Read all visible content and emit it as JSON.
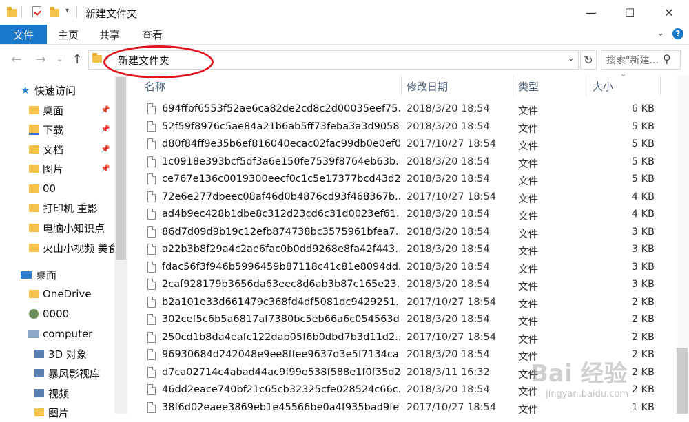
{
  "window": {
    "title": "新建文件夹",
    "minimize_glyph": "—",
    "maximize_glyph": "☐",
    "close_glyph": "✕"
  },
  "ribbon": {
    "file": "文件",
    "tabs": [
      "主页",
      "共享",
      "查看"
    ],
    "expand_glyph": "⌄",
    "help_glyph": "?"
  },
  "address": {
    "path": "新建文件夹",
    "search_placeholder": "搜索\"新建...",
    "back_glyph": "←",
    "forward_glyph": "→",
    "up_glyph": "↑",
    "dropdown_glyph": "⌄",
    "refresh_glyph": "↻",
    "search_glyph": "⚲"
  },
  "nav": {
    "items": [
      {
        "label": "快速访问",
        "icon": "star-icon",
        "pinned": false
      },
      {
        "label": "桌面",
        "icon": "desktop-folder-icon",
        "pinned": true
      },
      {
        "label": "下载",
        "icon": "download-folder-icon",
        "pinned": true
      },
      {
        "label": "文档",
        "icon": "documents-folder-icon",
        "pinned": true
      },
      {
        "label": "图片",
        "icon": "pictures-folder-icon",
        "pinned": true
      },
      {
        "label": "00",
        "icon": "folder-icon",
        "pinned": false
      },
      {
        "label": "打印机 重影",
        "icon": "folder-icon",
        "pinned": false
      },
      {
        "label": "电脑小知识点",
        "icon": "folder-icon",
        "pinned": false
      },
      {
        "label": "火山小视频 美食",
        "icon": "folder-icon",
        "pinned": false
      },
      {
        "label": "桌面",
        "icon": "desktop-icon",
        "pinned": false
      },
      {
        "label": "OneDrive",
        "icon": "onedrive-folder-icon",
        "pinned": false
      },
      {
        "label": "0000",
        "icon": "user-icon",
        "pinned": false
      },
      {
        "label": "computer",
        "icon": "computer-icon",
        "pinned": false
      },
      {
        "label": "3D 对象",
        "icon": "3d-objects-icon",
        "pinned": false
      },
      {
        "label": "暴风影视库",
        "icon": "media-library-icon",
        "pinned": false
      },
      {
        "label": "视频",
        "icon": "videos-icon",
        "pinned": false
      },
      {
        "label": "图片",
        "icon": "pictures-folder-icon",
        "pinned": false
      }
    ]
  },
  "columns": {
    "name": "名称",
    "date": "修改日期",
    "type": "类型",
    "size": "大小",
    "sort_glyph": "⌄"
  },
  "files": [
    {
      "name": "694ffbf6553f52ae6ca82de2cd8c2d00035eef75...",
      "date": "2018/3/20 18:54",
      "type": "文件",
      "size": "6 KB"
    },
    {
      "name": "52f59f8976c5ae84a21b6ab5ff73feba3a3d9058...",
      "date": "2018/3/20 18:54",
      "type": "文件",
      "size": "5 KB"
    },
    {
      "name": "d80f84ff9e35b6ef816040ecac02fac99db0e0ef0...",
      "date": "2017/10/27 18:54",
      "type": "文件",
      "size": "5 KB"
    },
    {
      "name": "1c0918e393bcf5df3a6e150fe7539f8764eb63b...",
      "date": "2018/3/20 18:54",
      "type": "文件",
      "size": "5 KB"
    },
    {
      "name": "ce767e136c0019300eecf0c1c5e17377bcd43d2...",
      "date": "2018/3/20 18:54",
      "type": "文件",
      "size": "5 KB"
    },
    {
      "name": "72e6e277dbeec08af46d0b4876cd93f468367b...",
      "date": "2017/10/27 18:54",
      "type": "文件",
      "size": "4 KB"
    },
    {
      "name": "ad4b9ec428b1dbe8c312d23cd6c31d0023ef61...",
      "date": "2018/3/20 18:54",
      "type": "文件",
      "size": "4 KB"
    },
    {
      "name": "86d7d09d9b19c12efb874738bc3575961bfea7...",
      "date": "2018/3/20 18:54",
      "type": "文件",
      "size": "3 KB"
    },
    {
      "name": "a22b3b8f29a4c2ae6fac0b0dd9268e8fa42f443...",
      "date": "2018/3/20 18:54",
      "type": "文件",
      "size": "3 KB"
    },
    {
      "name": "fdac56f3f946b5996459b87118c41c81e8094dd...",
      "date": "2018/3/20 18:54",
      "type": "文件",
      "size": "3 KB"
    },
    {
      "name": "2caf928179b3656da63eec8d6ab3b87c165e23...",
      "date": "2018/3/20 18:54",
      "type": "文件",
      "size": "3 KB"
    },
    {
      "name": "b2a101e33d661479c368fd4df5081dc9429251...",
      "date": "2017/10/27 18:54",
      "type": "文件",
      "size": "2 KB"
    },
    {
      "name": "302cef5c6b5a6817af7380bc5eb66a6c054563d...",
      "date": "2018/3/20 18:54",
      "type": "文件",
      "size": "2 KB"
    },
    {
      "name": "250cd1b8da4eafc122dab05f6b0dbd7b3d11d2...",
      "date": "2017/10/27 18:54",
      "type": "文件",
      "size": "2 KB"
    },
    {
      "name": "96930684d242048e9ee8ffee9637d3e5f7134ca...",
      "date": "2018/3/20 18:54",
      "type": "文件",
      "size": "2 KB"
    },
    {
      "name": "d7ca02714c4abad44ac9f99e538f588e1f0f35d2...",
      "date": "2018/3/11 16:32",
      "type": "文件",
      "size": "2 KB"
    },
    {
      "name": "46dd2eace740bf21c65cb32325cfe028524c66c...",
      "date": "2018/3/20 18:54",
      "type": "文件",
      "size": "2 KB"
    },
    {
      "name": "38f6d02eaee3869eb1e45566be0a4f935bad9fe...",
      "date": "2017/10/27 18:54",
      "type": "文件",
      "size": "1 KB"
    }
  ],
  "watermark": {
    "main": "Bai 经验",
    "sub": "jingyan.baidu.com"
  },
  "colors": {
    "file_tab": "#1979ca",
    "column_header": "#4c6079",
    "annotation_circle": "#e0141c",
    "star": "#2b7cd3"
  }
}
